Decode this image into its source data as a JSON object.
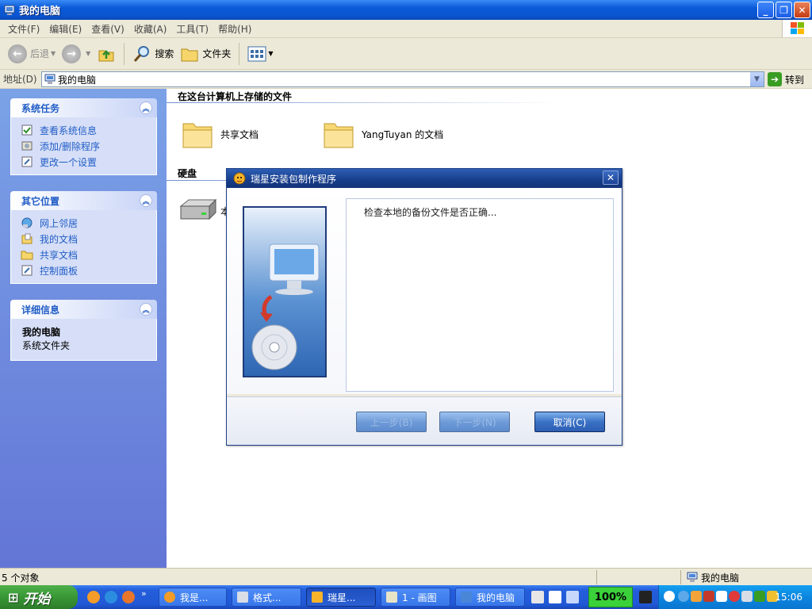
{
  "window": {
    "title": "我的电脑"
  },
  "menu": [
    "文件(F)",
    "编辑(E)",
    "查看(V)",
    "收藏(A)",
    "工具(T)",
    "帮助(H)"
  ],
  "toolbar": {
    "back": "后退",
    "search": "搜索",
    "folders": "文件夹"
  },
  "address": {
    "label": "地址(D)",
    "value": "我的电脑",
    "go": "转到"
  },
  "taskpane": {
    "system_tasks": {
      "title": "系统任务",
      "links": [
        "查看系统信息",
        "添加/删除程序",
        "更改一个设置"
      ]
    },
    "other_places": {
      "title": "其它位置",
      "links": [
        "网上邻居",
        "我的文档",
        "共享文档",
        "控制面板"
      ]
    },
    "details": {
      "title": "详细信息",
      "name": "我的电脑",
      "type": "系统文件夹"
    }
  },
  "content": {
    "group1_title": "在这台计算机上存储的文件",
    "items": [
      "共享文档",
      "YangTuyan 的文档"
    ],
    "group2_title": "硬盘",
    "drive_label": "本"
  },
  "dialog": {
    "title": "瑞星安装包制作程序",
    "message": "检查本地的备份文件是否正确...",
    "prev": "上一步(B)",
    "next": "下一步(N)",
    "cancel": "取消(C)"
  },
  "status": {
    "count": "5 个对象",
    "location": "我的电脑"
  },
  "taskbar": {
    "start": "开始",
    "tasks": [
      "我是...",
      "格式...",
      "瑞星...",
      "1 - 画图",
      "我的电脑"
    ],
    "zoom": "100%",
    "clock": "15:06"
  }
}
